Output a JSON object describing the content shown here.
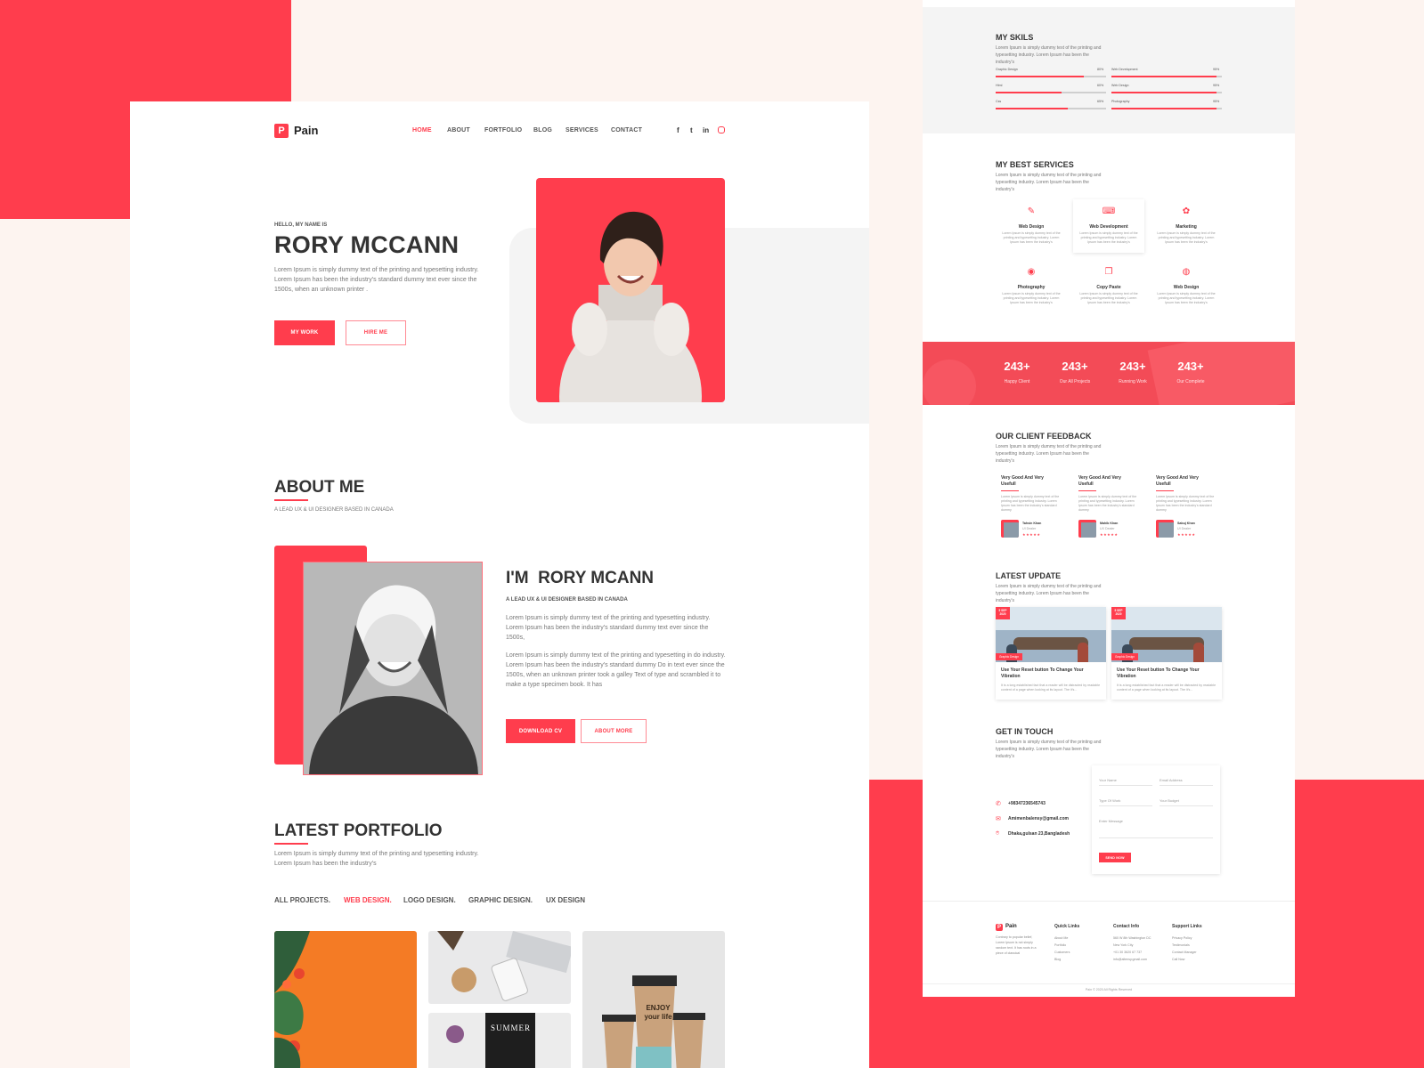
{
  "brand": {
    "logo_letter": "P",
    "name": "Pain"
  },
  "nav": [
    {
      "label": "HOME",
      "active": true
    },
    {
      "label": "ABOUT",
      "active": false
    },
    {
      "label": "FORTFOLIO",
      "active": false
    },
    {
      "label": "BLOG",
      "active": false
    },
    {
      "label": "SERVICES",
      "active": false
    },
    {
      "label": "CONTACT",
      "active": false
    }
  ],
  "social": [
    "f",
    "t",
    "in",
    "ig"
  ],
  "hero": {
    "greeting": "HELLO, MY NAME IS",
    "name": "RORY MCCANN",
    "desc": "Lorem Ipsum is simply dummy text of the printing and typesetting industry. Lorem Ipsum has been the industry's standard dummy text ever since the 1500s, when an unknown printer .",
    "btn_primary": "MY WORK",
    "btn_secondary": "HIRE ME"
  },
  "about": {
    "title": "ABOUT ME",
    "subtitle": "A LEAD UX & UI DESIGNER BASED IN CANADA",
    "heading": "I'M  RORY MCANN",
    "role": "A LEAD UX & UI DESIGNER BASED IN CANADA",
    "para1": "Lorem Ipsum is simply dummy text of the printing and typesetting industry. Lorem Ipsum has been the industry's standard dummy text ever since the 1500s,",
    "para2": "Lorem Ipsum is simply dummy text of the printing and typesetting in do industry. Lorem Ipsum has been the industry's standard dummy Do in text ever since the 1500s, when an unknown printer took a galley Text of type and scrambled it to make a type specimen book. It has",
    "btn_primary": "DOWNLOAD CV",
    "btn_secondary": "ABOUT MORE"
  },
  "portfolio": {
    "title": "LATEST PORTFOLIO",
    "desc": "Lorem Ipsum is simply dummy text of the printing and typesetting industry. Lorem Ipsum has been the industry's",
    "filters": [
      {
        "label": "ALL PROJECTS.",
        "active": false
      },
      {
        "label": "WEB DESIGN.",
        "active": true
      },
      {
        "label": "LOGO DESIGN.",
        "active": false
      },
      {
        "label": "GRAPHIC DESIGN.",
        "active": false
      },
      {
        "label": "UX DESIGN",
        "active": false
      }
    ],
    "summer_text": "SUMMER",
    "cup_text": "ENJOY your life"
  },
  "skills": {
    "title": "MY SKILS",
    "desc": "Lorem Ipsum is simply dummy text of the printing and typesetting industry. Lorem Ipsum has been the industry's",
    "items": [
      {
        "label": "Graphic Design",
        "pct_text": "80%",
        "value": 0.8
      },
      {
        "label": "Web Development",
        "pct_text": "95%",
        "value": 0.95
      },
      {
        "label": "Html",
        "pct_text": "60%",
        "value": 0.6
      },
      {
        "label": "Web Design",
        "pct_text": "95%",
        "value": 0.95
      },
      {
        "label": "Css",
        "pct_text": "65%",
        "value": 0.65
      },
      {
        "label": "Photography",
        "pct_text": "95%",
        "value": 0.95
      }
    ]
  },
  "services": {
    "title": "MY BEST SERVICES",
    "desc": "Lorem Ipsum is simply dummy text of the printing and typesetting industry. Lorem Ipsum has been the industry's",
    "items": [
      {
        "title": "Web Design",
        "icon": "pen-icon",
        "glyph": "✎"
      },
      {
        "title": "Web Development",
        "icon": "code-icon",
        "glyph": "⌨"
      },
      {
        "title": "Marketing",
        "icon": "megaphone-icon",
        "glyph": "✿"
      },
      {
        "title": "Photography",
        "icon": "camera-icon",
        "glyph": "◉"
      },
      {
        "title": "Copy Paste",
        "icon": "copy-icon",
        "glyph": "❐"
      },
      {
        "title": "Web Design",
        "icon": "globe-icon",
        "glyph": "◍"
      }
    ],
    "item_desc": "Lorem Ipsum is simply dummy text of the printing and typesetting industry. Lorem Ipsum has been the industry's"
  },
  "stats": [
    {
      "value": "243+",
      "label": "Happy Client"
    },
    {
      "value": "243+",
      "label": "Our All Projects"
    },
    {
      "value": "243+",
      "label": "Running Work"
    },
    {
      "value": "243+",
      "label": "Our Complete"
    }
  ],
  "feedback": {
    "title": "OUR CLIENT FEEDBACK",
    "desc": "Lorem Ipsum is simply dummy text of the printing and typesetting industry. Lorem Ipsum has been the industry's",
    "items": [
      {
        "heading": "Very Good And Very Usefull",
        "name": "Tahsin Khan",
        "role": "UI Dealer"
      },
      {
        "heading": "Very Good And Very Usefull",
        "name": "Mahib Khan",
        "role": "UX Dealer"
      },
      {
        "heading": "Very Good And Very Usefull",
        "name": "Sabuj Khan",
        "role": "UI Dealer"
      }
    ],
    "item_text": "Lorem Ipsum is simply dummy text of the printing and typesetting industry. Lorem Ipsum has been the industry's standard dummy",
    "stars": "★★★★★"
  },
  "updates": {
    "title": "LATEST UPDATE",
    "desc": "Lorem Ipsum is simply dummy text of the printing and typesetting industry. Lorem Ipsum has been the industry's",
    "items": [
      {
        "date": "5 SEP 2020",
        "tag": "Graphic Design",
        "title": "Use Your Reset button To Change Your Vibration"
      },
      {
        "date": "5 SEP 2020",
        "tag": "Graphic Design",
        "title": "Use Your Reset button To Change Your Vibration"
      }
    ],
    "item_text": "It is a long established fact that a reader will be distracted by readable content of a page when looking at its layout. The it's..."
  },
  "contact": {
    "title": "GET IN TOUCH",
    "desc": "Lorem Ipsum is simply dummy text of the printing and typesetting industry. Lorem Ipsum has been the industry's",
    "phone": "+98347236545743",
    "email": "Amimenbalensy@gmail.com",
    "address": "Dhaka,gulsan 23,Bangladesh",
    "form": {
      "name_ph": "Your Name",
      "email_ph": "Email Address",
      "type_ph": "Type Of Work",
      "budget_ph": "Your Budget",
      "message_ph": "Enter Message",
      "submit": "SEND NOW"
    }
  },
  "footer": {
    "brand_desc": "Contrary to popular belief, Lorem Ipsum is not simply random text. It has roots in a piece of classical",
    "cols": [
      {
        "title": "Quick Links",
        "items": [
          "About Me",
          "Portfolio",
          "Customers",
          "Blog"
        ]
      },
      {
        "title": "Contact Info",
        "items": [
          "560 W 8th Washington DC",
          "New York City",
          "+01 30 3620 67 737",
          "info@altensy.gmail.com"
        ]
      },
      {
        "title": "Support Links",
        "items": [
          "Privacy Policy",
          "Testimonials",
          "Contact Manager",
          "Call Now"
        ]
      }
    ],
    "copyright": "Pain © 2020 All Rights Reserved"
  },
  "colors": {
    "accent": "#ff3d4d",
    "page_bg": "#fdf4f0",
    "grey": "#f4f4f4"
  }
}
